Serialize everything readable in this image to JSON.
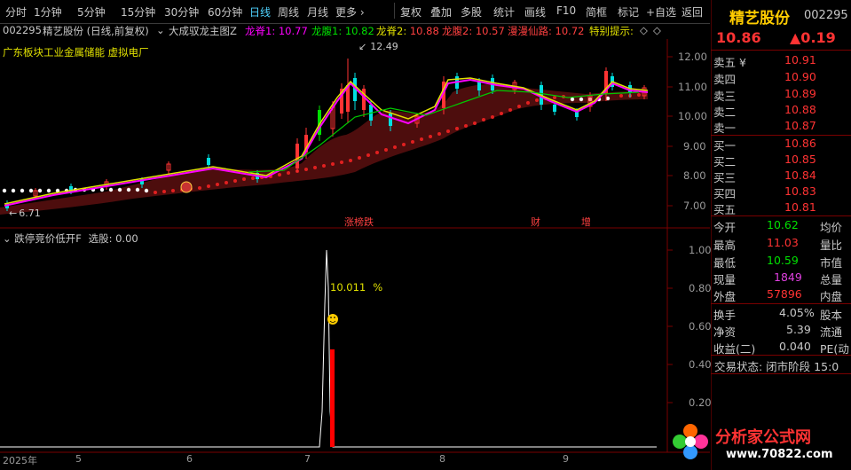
{
  "toolbar": {
    "periods": [
      "分时",
      "1分钟",
      "5分钟",
      "15分钟",
      "30分钟",
      "60分钟",
      "日线",
      "周线",
      "月线",
      "更多"
    ],
    "active": "日线",
    "more_arrow": "›",
    "tools": [
      "复权",
      "叠加",
      "多股",
      "统计",
      "画线",
      "F10",
      "简框",
      "标记",
      "+自选",
      "返回"
    ]
  },
  "chart_header": {
    "code": "002295",
    "name_period": "精艺股份 (日线,前复权)",
    "indicator": "大成驭龙主图Z",
    "items": [
      {
        "label": "龙脊1:",
        "value": "10.77",
        "color": "#ff00ff"
      },
      {
        "label": "龙腹1:",
        "value": "10.82",
        "color": "#00e000"
      },
      {
        "label": "龙脊2:",
        "value": "10.88",
        "color": "#e0e000"
      },
      {
        "label": "龙腹2:",
        "value": "10.57",
        "color": "#ff4040"
      },
      {
        "label": "漫漫仙路:",
        "value": "10.72",
        "color": "#ff4040"
      }
    ],
    "hint": "特别提示:",
    "sector_text": "广东板块工业金属储能 虚拟电厂"
  },
  "main_chart": {
    "y_ticks": [
      "12.00",
      "11.00",
      "10.00",
      "9.00",
      "8.00",
      "7.00"
    ],
    "high_label": "12.49",
    "low_label": "6.71",
    "events": [
      "涨榜跌",
      "财",
      "增"
    ]
  },
  "sub_chart": {
    "title": "跌停竞价低开F",
    "select_label": "选股: 0.00",
    "y_ticks": [
      "1.00",
      "0.80",
      "0.60",
      "0.40",
      "0.20"
    ],
    "annotation": "10.011",
    "annotation_unit": "%"
  },
  "x_axis": {
    "labels": [
      "2025年",
      "5",
      "6",
      "7",
      "8",
      "9"
    ]
  },
  "quote_panel": {
    "name": "精艺股份",
    "code": "002295",
    "price": "10.86",
    "change": "▲0.19",
    "asks": [
      {
        "label": "卖五 ¥",
        "price": "10.91"
      },
      {
        "label": "卖四",
        "price": "10.90"
      },
      {
        "label": "卖三",
        "price": "10.89"
      },
      {
        "label": "卖二",
        "price": "10.88"
      },
      {
        "label": "卖一",
        "price": "10.87"
      }
    ],
    "bids": [
      {
        "label": "买一",
        "price": "10.86"
      },
      {
        "label": "买二",
        "price": "10.85"
      },
      {
        "label": "买三",
        "price": "10.84"
      },
      {
        "label": "买四",
        "price": "10.83"
      },
      {
        "label": "买五",
        "price": "10.81"
      }
    ],
    "stats": [
      {
        "label": "今开",
        "value": "10.62",
        "color": "#00e000",
        "tail": "均价"
      },
      {
        "label": "最高",
        "value": "11.03",
        "color": "#ff3333",
        "tail": "量比"
      },
      {
        "label": "最低",
        "value": "10.59",
        "color": "#00e000",
        "tail": "市值"
      },
      {
        "label": "现量",
        "value": "1849",
        "color": "#e040e0",
        "tail": "总量"
      },
      {
        "label": "外盘",
        "value": "57896",
        "color": "#ff3333",
        "tail": "内盘"
      }
    ],
    "stats2": [
      {
        "label": "换手",
        "value": "4.05%",
        "tail": "股本"
      },
      {
        "label": "净资",
        "value": "5.39",
        "tail": "流通"
      },
      {
        "label": "收益(二)",
        "value": "0.040",
        "tail": "PE(动"
      }
    ],
    "trade_status": "交易状态: 闭市阶段 15:0"
  },
  "watermark": {
    "text": "分析家公式网",
    "url": "www.70822.com"
  }
}
